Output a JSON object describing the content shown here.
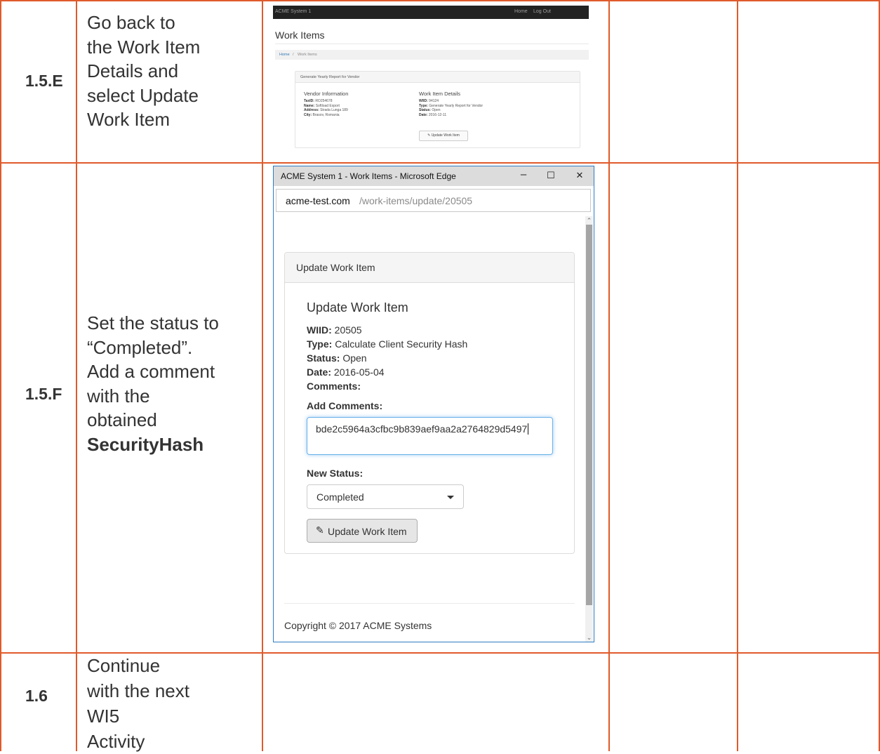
{
  "rows": [
    {
      "id": "1.5.E",
      "instruction_lines": [
        "Go back to",
        "the Work Item",
        "Details and",
        "select Update",
        "Work Item"
      ]
    },
    {
      "id": "1.5.F",
      "instruction_lines": [
        "Set the status to",
        "“Completed”.",
        "Add a comment",
        "with the",
        "obtained"
      ],
      "instruction_bold": "SecurityHash"
    },
    {
      "id": "1.6",
      "instruction_lines": [
        "Continue",
        "with the next",
        "WI5",
        "Activity"
      ]
    }
  ],
  "shot1": {
    "brand": "ACME System 1",
    "nav": [
      "Home",
      "Log Out"
    ],
    "page_title": "Work Items",
    "breadcrumb": [
      "Home",
      "/",
      "Work Items"
    ],
    "panel_title": "Generate Yearly Report for Vendor",
    "vendor": {
      "heading": "Vendor Information",
      "taxid_label": "TaxID:",
      "taxid": "RO254678",
      "name_label": "Name:",
      "name": "Softload Export",
      "address_label": "Address:",
      "address": "Strada Lunga 189",
      "city_label": "City:",
      "city": "Brasov, Romania"
    },
    "details": {
      "heading": "Work Item Details",
      "wiid_label": "WIID:",
      "wiid": "94124",
      "type_label": "Type:",
      "type": "Generate Yearly Report for Vendor",
      "status_label": "Status:",
      "status": "Open",
      "date_label": "Date:",
      "date": "2016-12-11"
    },
    "button": "Update Work Item"
  },
  "shot2": {
    "window_title": "ACME System 1 - Work Items - Microsoft Edge",
    "controls": {
      "minimize": "–",
      "maximize": "☐",
      "close": "✕"
    },
    "url_host": "acme-test.com",
    "url_path": "/work-items/update/20505",
    "panel_title": "Update Work Item",
    "heading": "Update Work Item",
    "wiid_label": "WIID:",
    "wiid": "20505",
    "type_label": "Type:",
    "type": "Calculate Client Security Hash",
    "status_label": "Status:",
    "status": "Open",
    "date_label": "Date:",
    "date": "2016-05-04",
    "comments_label": "Comments:",
    "add_comments_label": "Add Comments:",
    "comment_value": "bde2c5964a3cfbc9b839aef9aa2a2764829d5497",
    "new_status_label": "New Status:",
    "new_status_value": "Completed",
    "button": "Update Work Item",
    "footer": "Copyright © 2017 ACME Systems"
  },
  "colors": {
    "table_border": "#e05a2b",
    "window_border": "#2e7cc4"
  }
}
